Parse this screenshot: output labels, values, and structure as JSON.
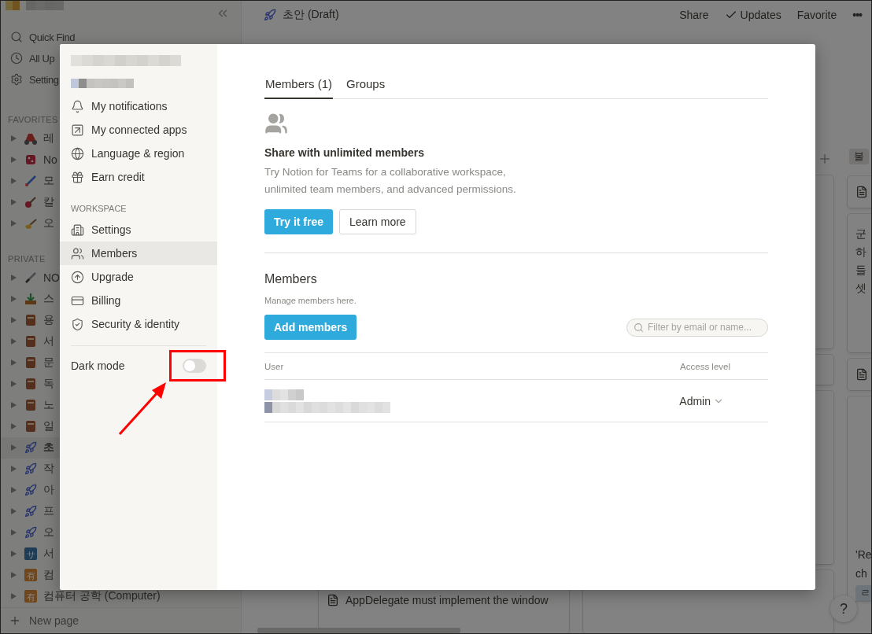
{
  "sidebar": {
    "quick_items": [
      {
        "kind": "search",
        "label": "Quick Find"
      },
      {
        "kind": "clock",
        "label": "All Up"
      },
      {
        "kind": "gear",
        "label": "Setting"
      }
    ],
    "favorites_label": "FAVORITES",
    "favorites": [
      {
        "kind": "scooter",
        "label": "레"
      },
      {
        "kind": "die",
        "label": "No"
      },
      {
        "kind": "brush",
        "label": "모"
      },
      {
        "kind": "guitar",
        "label": "칼"
      },
      {
        "kind": "broom",
        "label": "오"
      }
    ],
    "private_label": "PRIVATE",
    "private": [
      {
        "kind": "sword",
        "label": "NO",
        "selected": false
      },
      {
        "kind": "download",
        "label": "스",
        "selected": false
      },
      {
        "kind": "book",
        "label": "용",
        "selected": false
      },
      {
        "kind": "book",
        "label": "서",
        "selected": false
      },
      {
        "kind": "book",
        "label": "문",
        "selected": false
      },
      {
        "kind": "book",
        "label": "독",
        "selected": false
      },
      {
        "kind": "book",
        "label": "노",
        "selected": false
      },
      {
        "kind": "book",
        "label": "일",
        "selected": false
      },
      {
        "kind": "rocket",
        "label": "초",
        "selected": true
      },
      {
        "kind": "rocket",
        "label": "작",
        "selected": false
      },
      {
        "kind": "rocket",
        "label": "아",
        "selected": false
      },
      {
        "kind": "rocket",
        "label": "프",
        "selected": false
      },
      {
        "kind": "rocket",
        "label": "오",
        "selected": false
      },
      {
        "kind": "blue-badge",
        "badge": "サ",
        "label": "서",
        "selected": false
      },
      {
        "kind": "orange-badge",
        "badge": "有",
        "label": "컴",
        "selected": false
      },
      {
        "kind": "orange-badge",
        "badge": "有",
        "label": "컴퓨터 공학 (Computer)",
        "selected": false
      }
    ],
    "new_page": "New page"
  },
  "topbar": {
    "title": "초안 (Draft)",
    "actions": [
      {
        "kind": "text",
        "label": "Share"
      },
      {
        "kind": "check",
        "label": "Updates"
      },
      {
        "kind": "text",
        "label": "Favorite"
      },
      {
        "kind": "more",
        "label": "•••"
      }
    ]
  },
  "board": {
    "column_3_header": "불",
    "column_3_cards": [
      {
        "kind": "doc"
      },
      {
        "kind": "text",
        "lines": [
          "군",
          "하",
          "들",
          "셋"
        ]
      },
      {
        "kind": "doc"
      },
      {
        "kind": "doc",
        "lines": [
          "'Re",
          "ch"
        ],
        "tag": "ㄹ"
      }
    ],
    "column_1_card": "AppDelegate must implement the window",
    "help": "?"
  },
  "modal": {
    "nav_personal": [
      {
        "kind": "notifications",
        "label": "My notifications",
        "selected": false
      },
      {
        "kind": "apps",
        "label": "My connected apps",
        "selected": false
      },
      {
        "kind": "language",
        "label": "Language & region",
        "selected": false
      },
      {
        "kind": "credit",
        "label": "Earn credit",
        "selected": false
      }
    ],
    "workspace_label": "WORKSPACE",
    "nav_workspace": [
      {
        "kind": "settings",
        "label": "Settings",
        "selected": false
      },
      {
        "kind": "members",
        "label": "Members",
        "selected": true
      },
      {
        "kind": "upgrade",
        "label": "Upgrade",
        "selected": false
      },
      {
        "kind": "billing",
        "label": "Billing",
        "selected": false
      },
      {
        "kind": "security",
        "label": "Security & identity",
        "selected": false
      }
    ],
    "dark_mode": {
      "label": "Dark mode",
      "on": false
    },
    "tabs": [
      {
        "label": "Members (1)",
        "selected": true
      },
      {
        "label": "Groups",
        "selected": false
      }
    ],
    "promo": {
      "title": "Share with unlimited members",
      "text": "Try Notion for Teams for a collaborative workspace, unlimited team members, and advanced permissions.",
      "primary": "Try it free",
      "secondary": "Learn more"
    },
    "members": {
      "title": "Members",
      "subtitle": "Manage members here.",
      "add": "Add members",
      "filter": {
        "placeholder": "Filter by email or name..."
      },
      "columns": [
        "User",
        "Access level"
      ],
      "rows": [
        {
          "access": "Admin"
        }
      ]
    }
  }
}
